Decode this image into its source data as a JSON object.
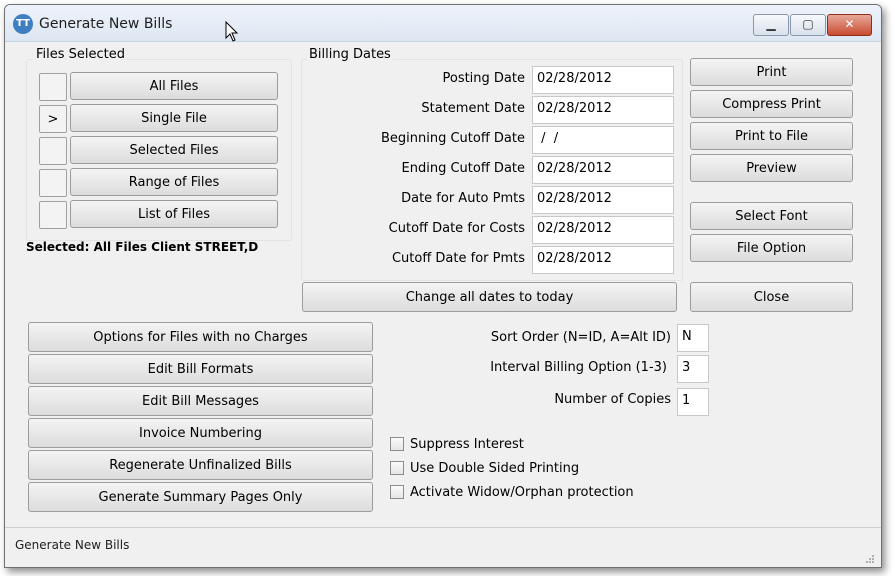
{
  "window": {
    "title": "Generate New Bills",
    "minimize": "▁",
    "maximize": "▢",
    "close": "✕",
    "icon_text": "TT"
  },
  "files_selected": {
    "label": "Files Selected",
    "markers": [
      "",
      ">",
      "",
      "",
      ""
    ],
    "buttons": [
      "All Files",
      "Single File",
      "Selected Files",
      "Range of Files",
      "List of Files"
    ],
    "summary": "Selected: All Files Client STREET,D"
  },
  "billing_dates": {
    "label": "Billing Dates",
    "rows": [
      {
        "label": "Posting Date",
        "value": "02/28/2012"
      },
      {
        "label": "Statement Date",
        "value": "02/28/2012"
      },
      {
        "label": "Beginning Cutoff Date",
        "value": " /  /"
      },
      {
        "label": "Ending Cutoff Date",
        "value": "02/28/2012"
      },
      {
        "label": "Date for Auto Pmts",
        "value": "02/28/2012"
      },
      {
        "label": "Cutoff Date for Costs",
        "value": "02/28/2012"
      },
      {
        "label": "Cutoff Date for Pmts",
        "value": "02/28/2012"
      }
    ],
    "change_all": "Change all dates to today"
  },
  "right_buttons": {
    "print": "Print",
    "compress_print": "Compress Print",
    "print_to_file": "Print to File",
    "preview": "Preview",
    "select_font": "Select Font",
    "file_option": "File Option",
    "close": "Close"
  },
  "left_buttons": [
    "Options for Files with no Charges",
    "Edit Bill Formats",
    "Edit Bill Messages",
    "Invoice Numbering",
    "Regenerate Unfinalized Bills",
    "Generate Summary Pages Only"
  ],
  "options": {
    "sort_order_label": "Sort Order (N=ID, A=Alt ID)",
    "sort_order_value": "N",
    "interval_label": "Interval Billing Option (1-3)",
    "interval_value": "3",
    "copies_label": "Number of Copies",
    "copies_value": "1"
  },
  "checkboxes": [
    {
      "label": "Suppress Interest",
      "checked": false
    },
    {
      "label": "Use Double Sided Printing",
      "checked": false
    },
    {
      "label": "Activate Widow/Orphan protection",
      "checked": false
    }
  ],
  "status": {
    "text": "Generate New Bills"
  }
}
